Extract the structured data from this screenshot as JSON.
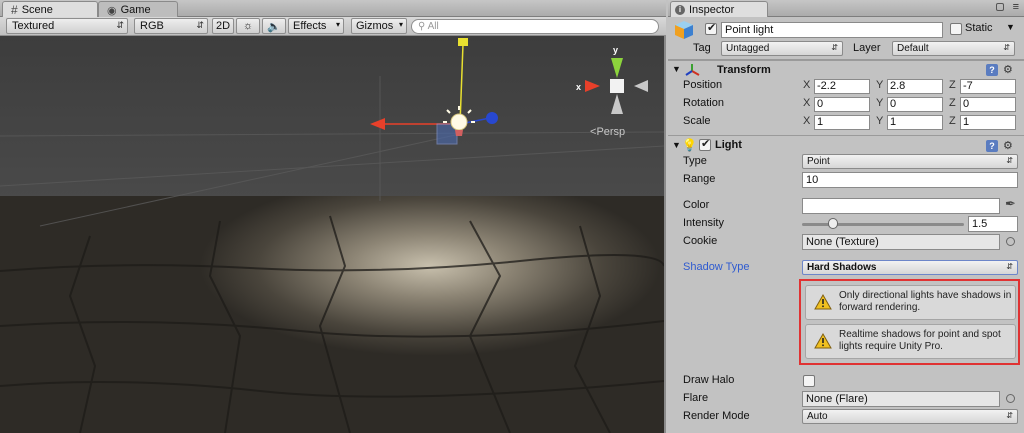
{
  "scene_tabs": {
    "scene": "Scene",
    "game": "Game"
  },
  "scene_toolbar": {
    "render_mode": "Textured",
    "color_mode": "RGB",
    "mode_2d": "2D",
    "effects": "Effects",
    "gizmos": "Gizmos",
    "search_placeholder": "All"
  },
  "scene_view": {
    "persp_label": "Persp",
    "gizmo_x": "x",
    "gizmo_y": "y"
  },
  "inspector": {
    "tab_label": "Inspector",
    "object_name": "Point light",
    "object_active": true,
    "static_label": "Static",
    "tag_label": "Tag",
    "tag_value": "Untagged",
    "layer_label": "Layer",
    "layer_value": "Default",
    "transform": {
      "title": "Transform",
      "position_label": "Position",
      "rotation_label": "Rotation",
      "scale_label": "Scale",
      "position": {
        "x": "-2.2",
        "y": "2.8",
        "z": "-7"
      },
      "rotation": {
        "x": "0",
        "y": "0",
        "z": "0"
      },
      "scale": {
        "x": "1",
        "y": "1",
        "z": "1"
      }
    },
    "axes": {
      "x": "X",
      "y": "Y",
      "z": "Z"
    },
    "light": {
      "title": "Light",
      "enabled": true,
      "type_label": "Type",
      "type_value": "Point",
      "range_label": "Range",
      "range_value": "10",
      "color_label": "Color",
      "color_value": "#ffffff",
      "intensity_label": "Intensity",
      "intensity_value": "1.5",
      "intensity_fraction": 0.19,
      "cookie_label": "Cookie",
      "cookie_value": "None (Texture)",
      "shadow_type_label": "Shadow Type",
      "shadow_type_value": "Hard Shadows",
      "warnings": [
        "Only directional lights have shadows in forward rendering.",
        "Realtime shadows for point and spot lights require Unity Pro."
      ],
      "draw_halo_label": "Draw Halo",
      "draw_halo_checked": false,
      "flare_label": "Flare",
      "flare_value": "None (Flare)",
      "render_mode_label": "Render Mode",
      "render_mode_value": "Auto"
    }
  },
  "colors": {
    "accent_blue": "#2f5bd0",
    "warning_border": "#e03232",
    "gizmo_x": "#e8402a",
    "gizmo_y": "#e8e030",
    "gizmo_z": "#2848d0"
  }
}
